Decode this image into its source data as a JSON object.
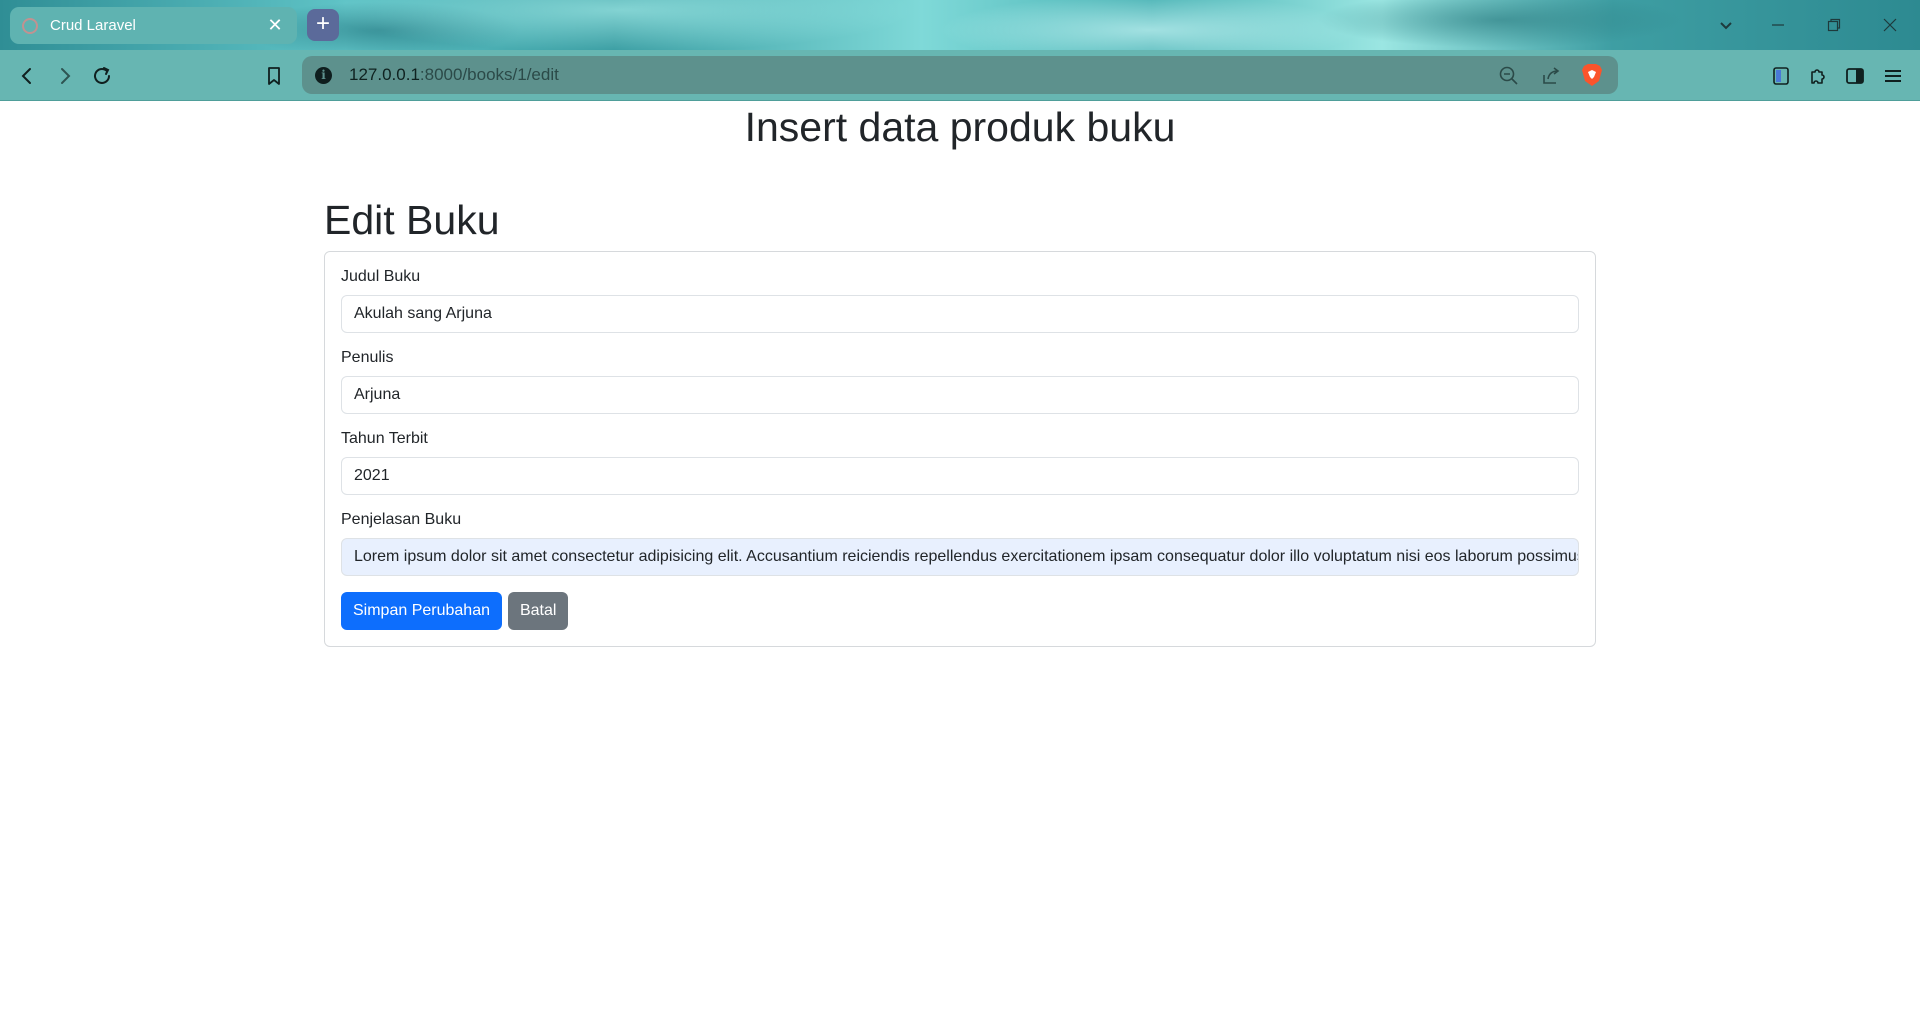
{
  "browser": {
    "tab": {
      "title": "Crud Laravel",
      "close": "✕"
    },
    "new_tab": "+",
    "url": {
      "host": "127.0.0.1",
      "rest": ":8000/books/1/edit"
    },
    "info": "i"
  },
  "page": {
    "main_title": "Insert data produk buku",
    "section_title": "Edit Buku"
  },
  "form": {
    "fields": [
      {
        "label": "Judul Buku",
        "value": "Akulah sang Arjuna"
      },
      {
        "label": "Penulis",
        "value": "Arjuna"
      },
      {
        "label": "Tahun Terbit",
        "value": "2021"
      },
      {
        "label": "Penjelasan Buku",
        "value": "Lorem ipsum dolor sit amet consectetur adipisicing elit. Accusantium reiciendis repellendus exercitationem ipsam consequatur dolor illo voluptatum nisi eos laborum possimus"
      }
    ],
    "submit_label": "Simpan Perubahan",
    "cancel_label": "Batal"
  },
  "colors": {
    "primary": "#0d6efd",
    "secondary": "#6c757d",
    "toolbar": "#67b6b2"
  }
}
